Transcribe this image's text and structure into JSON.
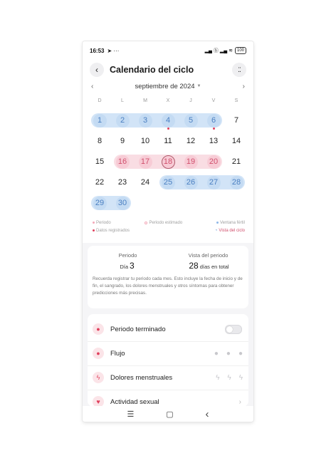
{
  "status": {
    "time": "16:53",
    "left_icons": "➤ ···",
    "right_icons": "▂▄ ⓑ ▂▄ ≋",
    "battery": "100"
  },
  "header": {
    "title": "Calendario del ciclo"
  },
  "month": {
    "label": "septiembre de 2024"
  },
  "weekdays": [
    "D",
    "L",
    "M",
    "X",
    "J",
    "V",
    "S"
  ],
  "days": [
    {
      "n": "1",
      "t": "blue"
    },
    {
      "n": "2",
      "t": "blue"
    },
    {
      "n": "3",
      "t": "blue"
    },
    {
      "n": "4",
      "t": "blue",
      "dot": true
    },
    {
      "n": "5",
      "t": "blue"
    },
    {
      "n": "6",
      "t": "blue",
      "dot": true
    },
    {
      "n": "7",
      "t": ""
    },
    {
      "n": "8",
      "t": ""
    },
    {
      "n": "9",
      "t": ""
    },
    {
      "n": "10",
      "t": ""
    },
    {
      "n": "11",
      "t": ""
    },
    {
      "n": "12",
      "t": ""
    },
    {
      "n": "13",
      "t": ""
    },
    {
      "n": "14",
      "t": ""
    },
    {
      "n": "15",
      "t": ""
    },
    {
      "n": "16",
      "t": "pink"
    },
    {
      "n": "17",
      "t": "pink"
    },
    {
      "n": "18",
      "t": "pink",
      "today": true
    },
    {
      "n": "19",
      "t": "pink"
    },
    {
      "n": "20",
      "t": "pink"
    },
    {
      "n": "21",
      "t": ""
    },
    {
      "n": "22",
      "t": ""
    },
    {
      "n": "23",
      "t": ""
    },
    {
      "n": "24",
      "t": ""
    },
    {
      "n": "25",
      "t": "blue"
    },
    {
      "n": "26",
      "t": "blue"
    },
    {
      "n": "27",
      "t": "blue"
    },
    {
      "n": "28",
      "t": "blue"
    },
    {
      "n": "29",
      "t": "blue"
    },
    {
      "n": "30",
      "t": "blue"
    }
  ],
  "legend": {
    "periodo": "Periodo",
    "estimado": "Periodo estimado",
    "fertil": "Ventana fértil",
    "datos": "Datos registrados",
    "vista": "Vista del ciclo"
  },
  "colors": {
    "blue": "#d2e4f7",
    "pink": "#f9dde3",
    "accent": "#e0405d"
  },
  "summary": {
    "periodo_label": "Periodo",
    "dia_prefix": "Día",
    "dia_value": "3",
    "vista_label": "Vista del periodo",
    "dias_value": "28",
    "dias_suffix": "días en total",
    "tip": "Recuerda registrar tu periodo cada mes. Esto incluye la fecha de inicio y de fin, el sangrado, los dolores menstruales y otros síntomas para obtener predicciones más precisas."
  },
  "events": [
    {
      "label": "Periodo terminado",
      "icon": "drop-flame-icon",
      "control": "toggle"
    },
    {
      "label": "Flujo",
      "icon": "drop-icon",
      "control": "drops"
    },
    {
      "label": "Dolores menstruales",
      "icon": "lightning-icon",
      "control": "bolts"
    },
    {
      "label": "Actividad sexual",
      "icon": "heart-icon",
      "control": "chevron"
    }
  ],
  "nav": {
    "menu": "☰",
    "home": "▢",
    "back": "‹"
  }
}
